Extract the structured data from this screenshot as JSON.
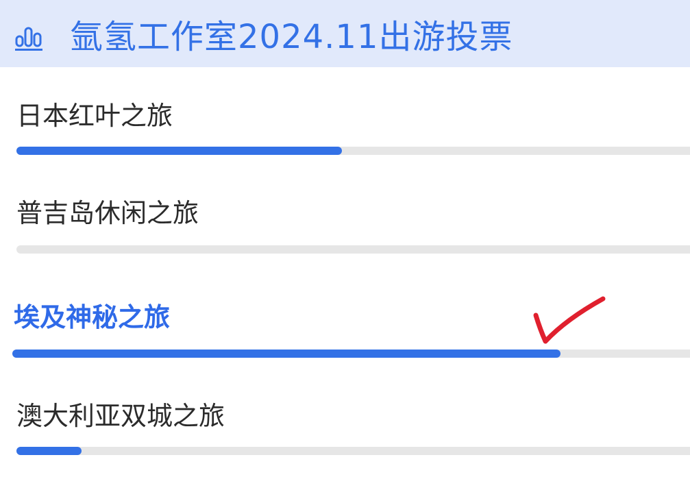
{
  "header": {
    "title": "氩氢工作室2024.11出游投票",
    "icon": "bar-chart-icon",
    "background": "#e1e9fb",
    "accent": "#3371e6"
  },
  "options": [
    {
      "label": "日本红叶之旅",
      "progress": 0.475,
      "selected": false
    },
    {
      "label": "普吉岛休闲之旅",
      "progress": 0,
      "selected": false
    },
    {
      "label": "埃及神秘之旅",
      "progress": 0.8,
      "selected": true
    },
    {
      "label": "澳大利亚双城之旅",
      "progress": 0.095,
      "selected": false
    }
  ],
  "annotation": {
    "icon": "check-mark-icon",
    "color": "#e0202e"
  }
}
